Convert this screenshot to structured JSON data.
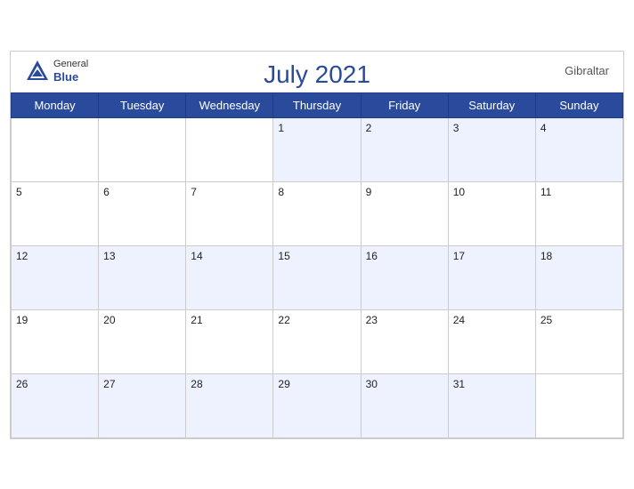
{
  "header": {
    "title": "July 2021",
    "logo_general": "General",
    "logo_blue": "Blue",
    "region": "Gibraltar"
  },
  "weekdays": [
    "Monday",
    "Tuesday",
    "Wednesday",
    "Thursday",
    "Friday",
    "Saturday",
    "Sunday"
  ],
  "weeks": [
    [
      null,
      null,
      null,
      1,
      2,
      3,
      4
    ],
    [
      5,
      6,
      7,
      8,
      9,
      10,
      11
    ],
    [
      12,
      13,
      14,
      15,
      16,
      17,
      18
    ],
    [
      19,
      20,
      21,
      22,
      23,
      24,
      25
    ],
    [
      26,
      27,
      28,
      29,
      30,
      31,
      null
    ]
  ]
}
